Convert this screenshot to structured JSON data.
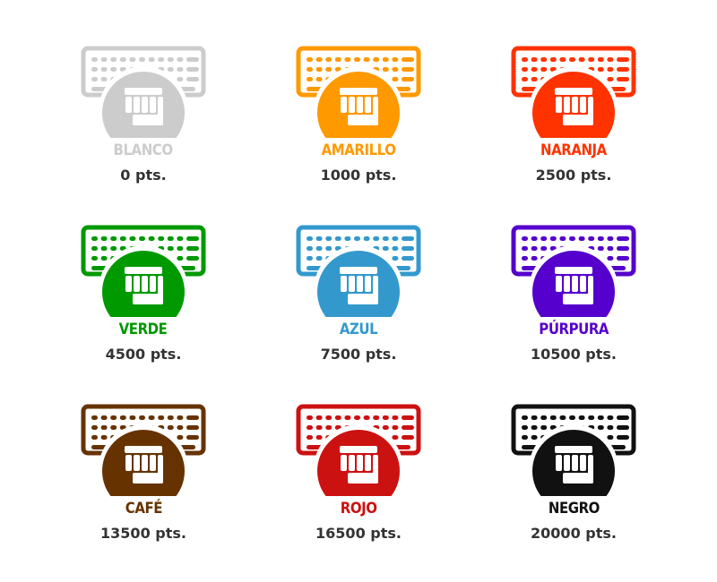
{
  "badges": [
    {
      "name": "BLANCO",
      "points": "0 pts.",
      "color": "#cccccc"
    },
    {
      "name": "AMARILLO",
      "points": "1000 pts.",
      "color": "#ff9900"
    },
    {
      "name": "NARANJA",
      "points": "2500 pts.",
      "color": "#ff3300"
    },
    {
      "name": "VERDE",
      "points": "4500 pts.",
      "color": "#009900"
    },
    {
      "name": "AZUL",
      "points": "7500 pts.",
      "color": "#3399cc"
    },
    {
      "name": "PÚRPURA",
      "points": "10500 pts.",
      "color": "#5500cc"
    },
    {
      "name": "CAFÉ",
      "points": "13500 pts.",
      "color": "#663300"
    },
    {
      "name": "ROJO",
      "points": "16500 pts.",
      "color": "#cc1111"
    },
    {
      "name": "NEGRO",
      "points": "20000 pts.",
      "color": "#111111"
    }
  ],
  "icon": "keyboard-fist-icon"
}
